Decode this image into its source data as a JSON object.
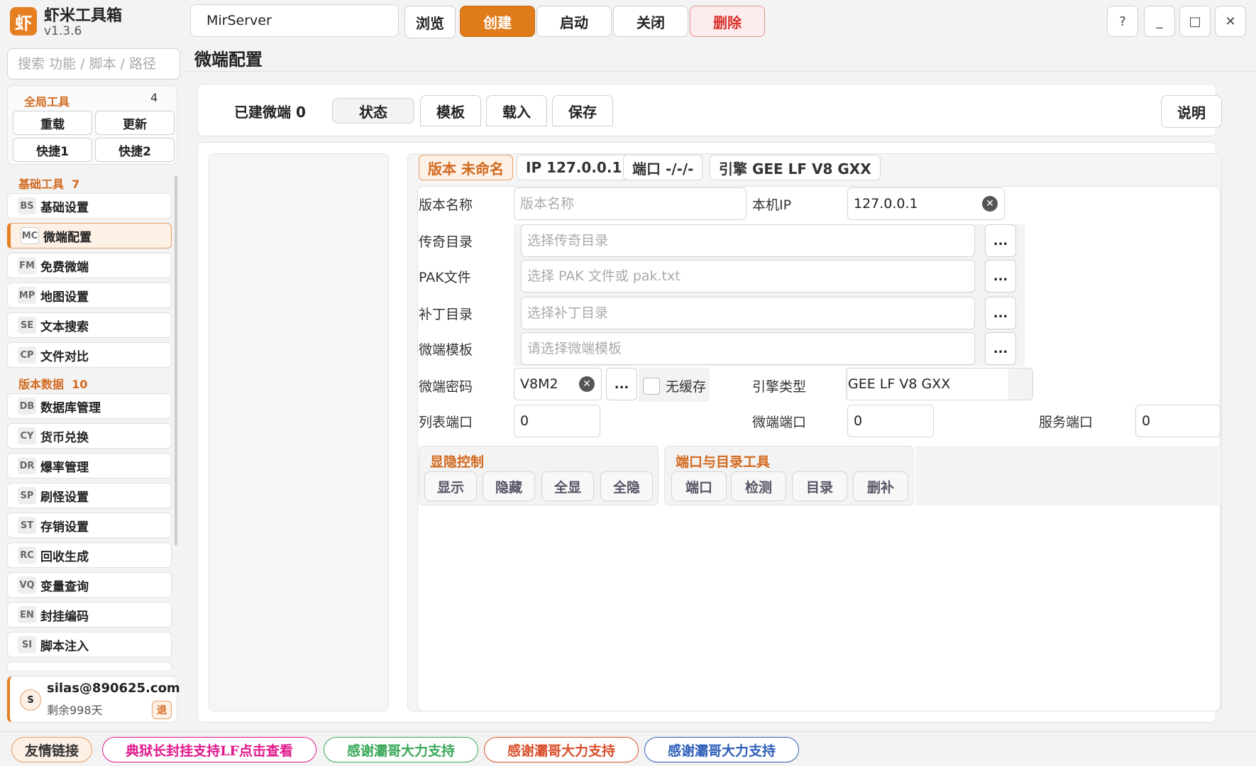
{
  "app": {
    "logo": "虾",
    "title": "虾米工具箱",
    "version": "v1.3.6"
  },
  "search": {
    "placeholder": "搜索 功能 / 脚本 / 路径"
  },
  "global_tools": {
    "title": "全局工具",
    "count": "4",
    "buttons": [
      "重载",
      "更新",
      "快捷1",
      "快捷2"
    ]
  },
  "basic_tools": {
    "title": "基础工具",
    "count": "7"
  },
  "version_data": {
    "title": "版本数据",
    "count": "10"
  },
  "sidebar_items": [
    {
      "code": "BS",
      "label": "基础设置"
    },
    {
      "code": "MC",
      "label": "微端配置"
    },
    {
      "code": "FM",
      "label": "免费微端"
    },
    {
      "code": "MP",
      "label": "地图设置"
    },
    {
      "code": "SE",
      "label": "文本搜索"
    },
    {
      "code": "CP",
      "label": "文件对比"
    },
    {
      "code": "DB",
      "label": "数据库管理"
    },
    {
      "code": "CY",
      "label": "货币兑换"
    },
    {
      "code": "DR",
      "label": "爆率管理"
    },
    {
      "code": "SP",
      "label": "刷怪设置"
    },
    {
      "code": "ST",
      "label": "存销设置"
    },
    {
      "code": "RC",
      "label": "回收生成"
    },
    {
      "code": "VQ",
      "label": "变量查询"
    },
    {
      "code": "EN",
      "label": "封挂编码"
    },
    {
      "code": "SI",
      "label": "脚本注入"
    }
  ],
  "user": {
    "avatar": "S",
    "email": "silas@890625.com",
    "days": "剩余998天",
    "logout": "退"
  },
  "topbar": {
    "server": "MirServer",
    "browse": "浏览",
    "create": "创建",
    "start": "启动",
    "close": "关闭",
    "delete": "删除",
    "help": "?",
    "minimize": "_",
    "maximize": "□",
    "close_window": "✕"
  },
  "page_title": "微端配置",
  "toolbar": {
    "built_label": "已建微端 0",
    "status": "状态",
    "template": "模板",
    "load": "载入",
    "save": "保存",
    "explain": "说明"
  },
  "chips": {
    "version": "版本 未命名",
    "ip": "IP 127.0.0.1",
    "port": "端口 -/-/-",
    "engine": "引擎 GEE LF V8 GXX"
  },
  "form": {
    "version_name_label": "版本名称",
    "version_name_placeholder": "版本名称",
    "local_ip_label": "本机IP",
    "local_ip_value": "127.0.0.1",
    "legend_dir_label": "传奇目录",
    "legend_dir_placeholder": "选择传奇目录",
    "pak_label": "PAK文件",
    "pak_placeholder": "选择 PAK 文件或 pak.txt",
    "patch_dir_label": "补丁目录",
    "patch_dir_placeholder": "选择补丁目录",
    "template_label": "微端模板",
    "template_placeholder": "请选择微端模板",
    "password_label": "微端密码",
    "password_value": "V8M2",
    "no_cache_label": "无缓存",
    "engine_type_label": "引擎类型",
    "engine_type_value": "GEE LF V8 GXX",
    "list_port_label": "列表端口",
    "list_port_value": "0",
    "micro_port_label": "微端端口",
    "micro_port_value": "0",
    "service_port_label": "服务端口",
    "service_port_value": "0",
    "browse_dots": "..."
  },
  "visibility": {
    "title": "显隐控制",
    "show": "显示",
    "hide": "隐藏",
    "show_all": "全显",
    "hide_all": "全隐"
  },
  "port_tools": {
    "title": "端口与目录工具",
    "port": "端口",
    "detect": "检测",
    "dir": "目录",
    "delete_patch": "删补"
  },
  "footer": {
    "friends": "友情链接",
    "link1": "典狱长封挂支持LF点击查看",
    "link2": "感谢灞哥大力支持",
    "link3": "感谢灞哥大力支持",
    "link4": "感谢灞哥大力支持"
  },
  "colors": {
    "accent": "#e07b1a",
    "danger": "#d9302c",
    "link_pink": "#e0198c",
    "link_green": "#3aa85a",
    "link_red": "#d9502c",
    "link_blue": "#2d5fb8"
  }
}
